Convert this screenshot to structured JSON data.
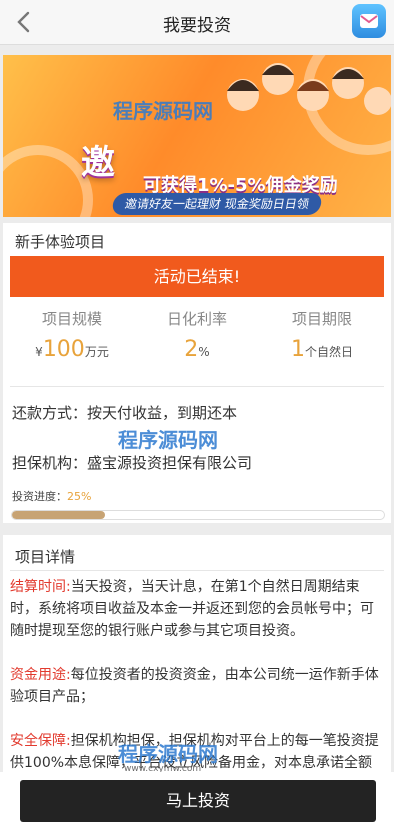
{
  "header": {
    "title": "我要投资",
    "back_icon": "back-arrow-icon",
    "right_icon": "message-icon"
  },
  "banner": {
    "headline": "邀",
    "subline": "可获得1%-5%佣金奖励",
    "pill": "邀请好友一起理财 现金奖励日日领"
  },
  "project": {
    "section_title": "新手体验项目",
    "status": "活动已结束!",
    "stats": [
      {
        "label": "项目规模",
        "prefix": "¥",
        "value": "100",
        "unit": "万元"
      },
      {
        "label": "日化利率",
        "prefix": "",
        "value": "2",
        "unit": "%"
      },
      {
        "label": "项目期限",
        "prefix": "",
        "value": "1",
        "unit": "个自然日"
      }
    ],
    "repayment_label": "还款方式：",
    "repayment_value": "按天付收益，到期还本",
    "guarantor_label": "担保机构：",
    "guarantor_value": "盛宝源投资担保有限公司",
    "progress_label": "投资进度：",
    "progress_text": "25%",
    "progress_fraction": 0.25
  },
  "details": {
    "section_title": "项目详情",
    "items": [
      {
        "title": "结算时间:",
        "text": "当天投资，当天计息，在第1个自然日周期结束时，系统将项目收益及本金一并返还到您的会员帐号中；可随时提现至您的银行账户或参与其它项目投资。"
      },
      {
        "title": "资金用途:",
        "text": "每位投资者的投资资金，由本公司统一运作新手体验项目产品；"
      },
      {
        "title": "安全保障:",
        "text": "担保机构担保，担保机构对平台上的每一笔投资提供100%本息保障，平台设立风险备用金，对本息承诺全额"
      }
    ]
  },
  "watermark": {
    "text": "程序源码网",
    "url": "www.cxymw.com"
  },
  "cta": {
    "label": "马上投资"
  },
  "colors": {
    "accent": "#f15a1d",
    "highlight": "#e23a2e",
    "gold": "#e8a33b",
    "cta": "#232323"
  }
}
